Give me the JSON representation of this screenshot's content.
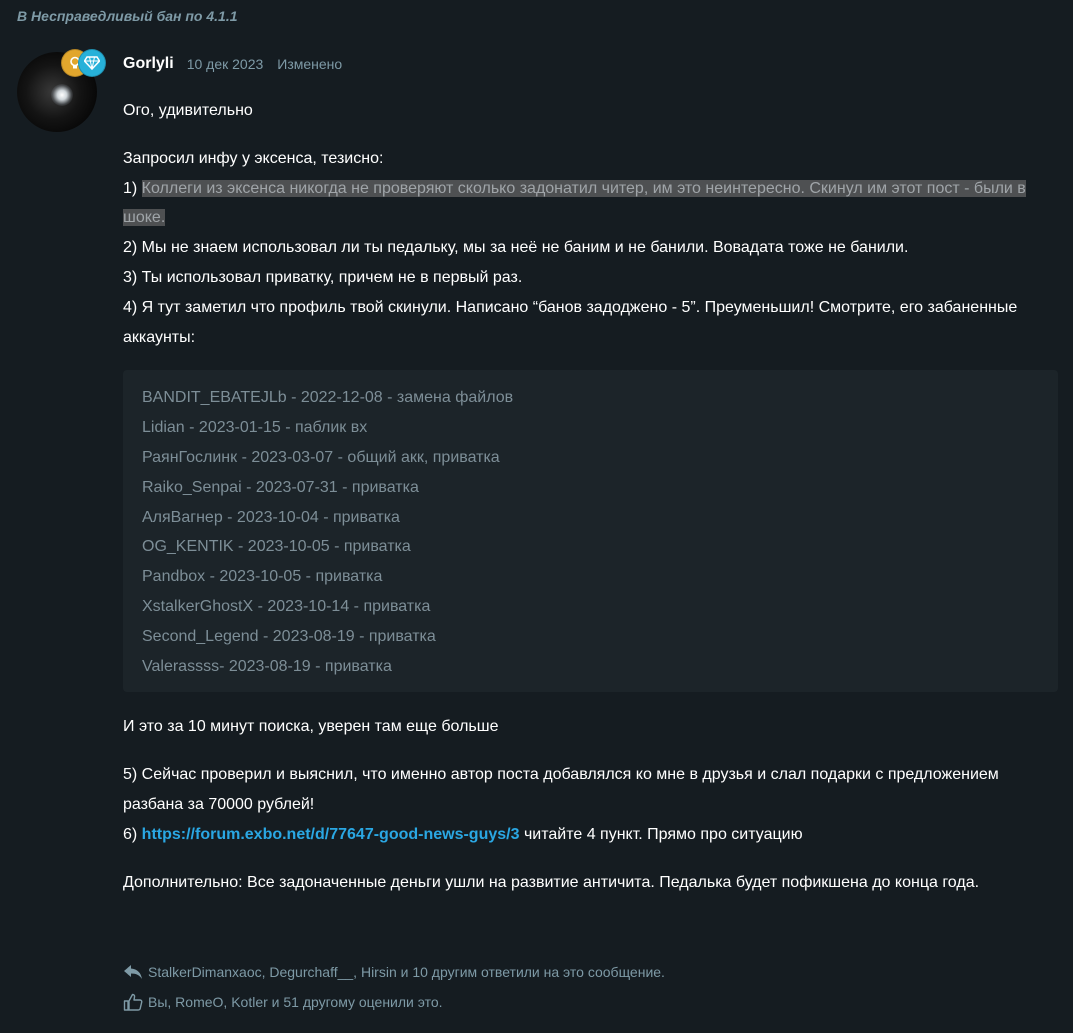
{
  "discussion_link": "В Несправедливый бан по 4.1.1",
  "post": {
    "author": "Gorlyli",
    "date": "10 дек 2023",
    "edited": "Изменено",
    "intro": "Ого, удивительно",
    "request_line": "Запросил инфу у эксенса, тезисно:",
    "point1_prefix": "1) ",
    "point1_highlight": "Коллеги из эксенса никогда не проверяют сколько задонатил читер, им это неинтересно. Скинул им этот пост - были в шоке.",
    "point2": "2) Мы не знаем использовал ли ты педальку, мы за неё не баним и не банили. Вовадата тоже не банили.",
    "point3": "3) Ты использовал приватку, причем не в первый раз.",
    "point4": "4) Я тут заметил что профиль твой скинули. Написано “банов задоджено - 5”. Преуменьшил! Смотрите, его забаненные аккаунты:",
    "banned_accounts": [
      "BANDIT_EBATEJLb - 2022-12-08 - замена файлов",
      "Lidian - 2023-01-15 - паблик вх",
      "РаянГослинк - 2023-03-07 - общий акк, приватка",
      "Raiko_Senpai - 2023-07-31 - приватка",
      "АляВагнер - 2023-10-04 - приватка",
      "OG_KENTIK - 2023-10-05 - приватка",
      "Pandbox - 2023-10-05 - приватка",
      "XstalkerGhostX - 2023-10-14 - приватка",
      "Second_Legend - 2023-08-19 - приватка",
      "Valerassss- 2023-08-19 - приватка"
    ],
    "after_list": "И это за 10 минут поиска, уверен там еще больше",
    "point5": "5) Сейчас проверил и выяснил, что именно автор поста добавлялся ко мне в друзья и слал подарки с предложением разбана за 70000 рублей!",
    "point6_prefix": "6) ",
    "point6_link": "https://forum.exbo.net/d/77647-good-news-guys/3",
    "point6_suffix": " читайте 4 пункт. Прямо про ситуацию",
    "additional": "Дополнительно: Все задоначенные деньги ушли на развитие античита. Педалька будет пофикшена до конца года."
  },
  "footer": {
    "replies": "StalkerDimanxaoc, Degurchaff__, Hirsin и 10 другим ответили на это сообщение.",
    "likes": "Вы, RomeO, Kotler и 51 другому оценили это."
  },
  "icons": {
    "badge_left": "lightbulb-icon",
    "badge_right": "diamond-icon",
    "reply": "reply-icon",
    "like": "thumbs-up-icon"
  },
  "colors": {
    "background": "#151c21",
    "muted": "#7e9aa6",
    "link": "#2aa7e3",
    "codebox": "#1c2429",
    "highlight": "#4e5052",
    "badge_gold": "#e1a62d",
    "badge_cyan": "#27b1d9"
  }
}
